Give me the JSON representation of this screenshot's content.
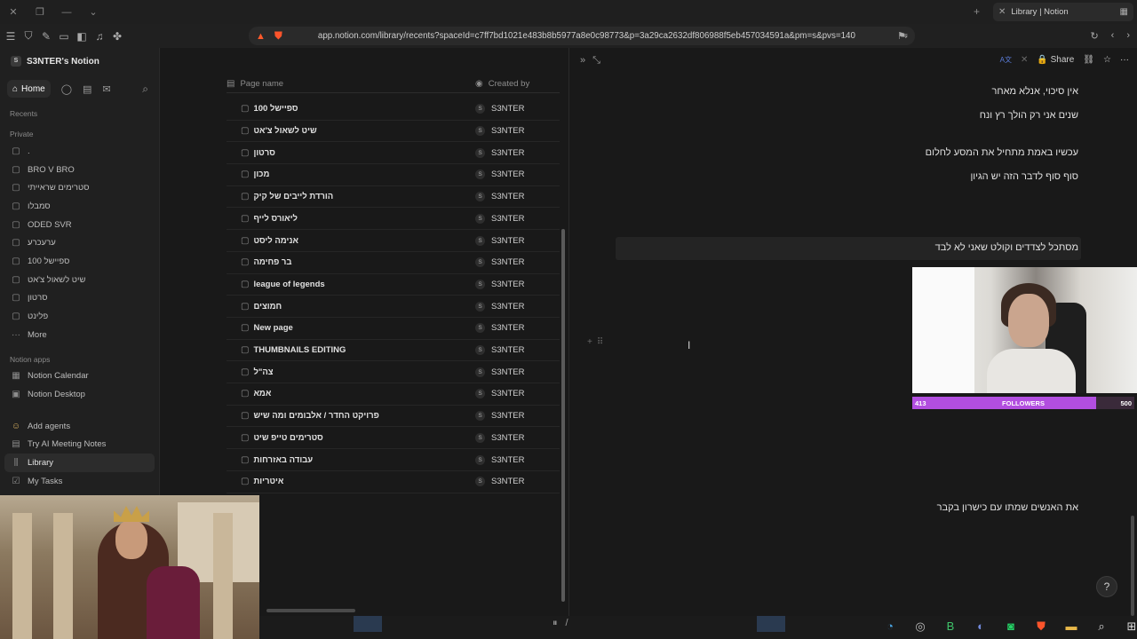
{
  "browser": {
    "tab_title": "Library | Notion",
    "url": "app.notion.com/library/recents?spaceId=c7ff7bd1021e483b8b5977a8e0c98773&p=3a29ca2632df806988f5eb457034591a&pm=s&pvs=140"
  },
  "sidebar": {
    "workspace": "S3NTER's Notion",
    "workspace_initial": "S",
    "home": "Home",
    "recents": "Recents",
    "private": "Private",
    "items": [
      ".",
      "BRO V BRO",
      "סטרימים שראייתי",
      "סמבלו",
      "ODED SVR",
      "ערעכרע",
      "ספיישל 100",
      "שיט לשאול צ'אט",
      "סרטון",
      "פלינט"
    ],
    "more": "More",
    "notion_apps": "Notion apps",
    "calendar": "Notion Calendar",
    "desktop": "Notion Desktop",
    "add_agents": "Add agents",
    "meeting_notes": "Try AI Meeting Notes",
    "library": "Library",
    "my_tasks": "My Tasks"
  },
  "table": {
    "col_name": "Page name",
    "col_by": "Created by",
    "creator": "S3NTER",
    "creator_initial": "S",
    "rows": [
      "ספיישל 100",
      "שיט לשאול צ'אט",
      "סרטון",
      "מכון",
      "הורדת לייבים של קיק",
      "ליאורס לייף",
      "אנימה ליסט",
      "בר פחימה",
      "league of legends",
      "חמוצים",
      "New page",
      "THUMBNAILS EDITING",
      "צה\"ל",
      "אמא",
      "פרויקט החדר / אלבומים ומה שיש",
      "סטרימים טייפ שיט",
      "עבודה באזרחות",
      "איטריות"
    ]
  },
  "peek": {
    "lang": "A文",
    "share": "Share",
    "lines": [
      "אין סיכוי, אנלא מאחר",
      "שנים אני רק הולך רץ ונח",
      "עכשיו באמת מתחיל את המסע לחלום",
      "סוף סוף לדבר הזה יש הגיון",
      "מסתכל לצדדים וקולט שאני לא לבד",
      "את האנשים שמתו עם כישרון בקבר"
    ]
  },
  "overlay": {
    "followers_label": "FOLLOWERS",
    "followers_current": "413",
    "followers_goal": "500",
    "followers_progress": 0.826
  }
}
